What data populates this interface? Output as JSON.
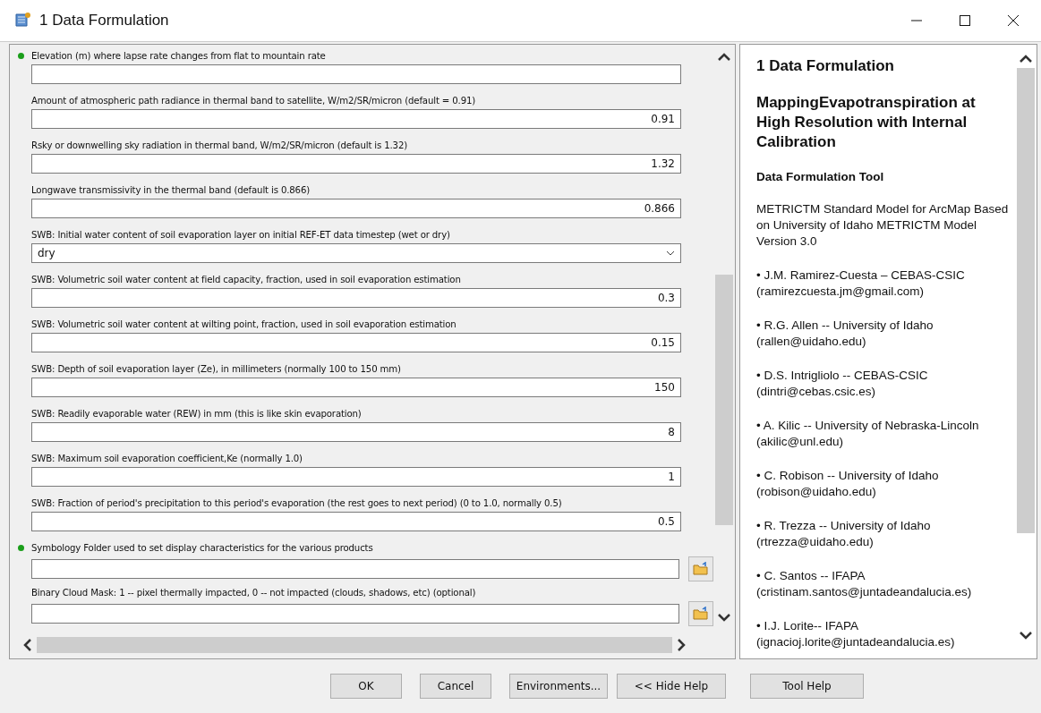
{
  "window": {
    "title": "1 Data Formulation"
  },
  "parameters": [
    {
      "label": "Elevation (m) where lapse rate changes from flat to mountain rate",
      "kind": "text",
      "required": true
    },
    {
      "label": "Amount of atmospheric path radiance in thermal band to satellite, W/m2/SR/micron (default = 0.91)",
      "value": "0.91",
      "kind": "text",
      "required": false
    },
    {
      "label": "Rsky or downwelling sky radiation in thermal band, W/m2/SR/micron (default is 1.32)",
      "value": "1.32",
      "kind": "text",
      "required": false
    },
    {
      "label": "Longwave transmissivity in the thermal band (default is 0.866)",
      "value": "0.866",
      "kind": "text",
      "required": false
    },
    {
      "label": "SWB: Initial water content of soil evaporation layer on initial REF-ET data timestep (wet or dry)",
      "value": "dry",
      "kind": "dropdown",
      "required": false
    },
    {
      "label": "SWB: Volumetric soil water content at field capacity, fraction, used in soil evaporation estimation",
      "value": "0.3",
      "kind": "text",
      "required": false
    },
    {
      "label": "SWB: Volumetric soil water content at wilting point, fraction, used in soil evaporation estimation",
      "value": "0.15",
      "kind": "text",
      "required": false
    },
    {
      "label": "SWB: Depth of soil evaporation layer (Ze), in millimeters (normally 100 to 150 mm)",
      "value": "150",
      "kind": "text",
      "required": false
    },
    {
      "label": "SWB: Readily evaporable water (REW) in mm (this is like skin evaporation)",
      "value": "8",
      "kind": "text",
      "required": false
    },
    {
      "label": "SWB: Maximum soil evaporation coefficient,Ke (normally 1.0)",
      "value": "1",
      "kind": "text",
      "required": false
    },
    {
      "label": "SWB: Fraction of period's precipitation to this period's evaporation (the rest goes to next period) (0 to 1.0, normally 0.5)",
      "value": "0.5",
      "kind": "text",
      "required": false
    },
    {
      "label": "Symbology Folder used to set display characteristics for the various products",
      "kind": "folder",
      "required": true
    },
    {
      "label": "Binary Cloud Mask: 1 -- pixel thermally impacted, 0 -- not impacted (clouds, shadows, etc) (optional)",
      "kind": "folder",
      "required": false
    }
  ],
  "help": {
    "title": "1 Data Formulation",
    "heading": "MappingEvapotranspiration at High Resolution with Internal Calibration",
    "subheading": "Data Formulation Tool",
    "description": "METRICTM Standard Model for ArcMap Based on University of Idaho METRICTM Model Version 3.0",
    "authors": [
      {
        "name": "• J.M. Ramirez-Cuesta – CEBAS-CSIC",
        "email": "(ramirezcuesta.jm@gmail.com)"
      },
      {
        "name": "• R.G. Allen -- University of Idaho",
        "email": "(rallen@uidaho.edu)"
      },
      {
        "name": "• D.S. Intrigliolo -- CEBAS-CSIC",
        "email": "(dintri@cebas.csic.es)"
      },
      {
        "name": "• A. Kilic -- University of Nebraska-Lincoln",
        "email": "(akilic@unl.edu)"
      },
      {
        "name": "• C. Robison -- University of Idaho",
        "email": "(robison@uidaho.edu)"
      },
      {
        "name": "• R. Trezza -- University of Idaho",
        "email": "(rtrezza@uidaho.edu)"
      },
      {
        "name": "• C. Santos -- IFAPA",
        "email": "(cristinam.santos@juntadeandalucia.es)"
      },
      {
        "name": "• I.J. Lorite-- IFAPA",
        "email": "(ignacioj.lorite@juntadeandalucia.es)"
      }
    ]
  },
  "buttons": [
    "OK",
    "Cancel",
    "Environments...",
    "<< Hide Help",
    "Tool Help"
  ]
}
